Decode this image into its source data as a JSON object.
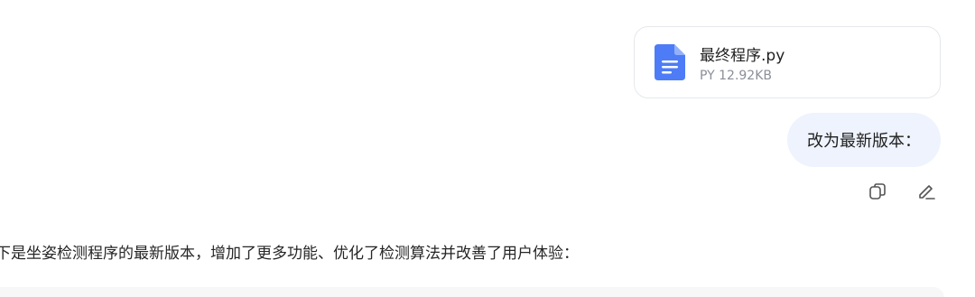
{
  "attachment": {
    "file_name": "最终程序.py",
    "file_meta": "PY 12.92KB",
    "icon": "document-icon",
    "icon_color": "#4d7cf6"
  },
  "user_message": {
    "text": "改为最新版本："
  },
  "message_actions": {
    "copy_icon": "copy-icon",
    "edit_icon": "edit-icon"
  },
  "assistant_message": {
    "text": "下是坐姿检测程序的最新版本，增加了更多功能、优化了检测算法并改善了用户体验："
  },
  "colors": {
    "bubble_bg": "#eef3fd",
    "code_bg": "#f7f7f8"
  }
}
